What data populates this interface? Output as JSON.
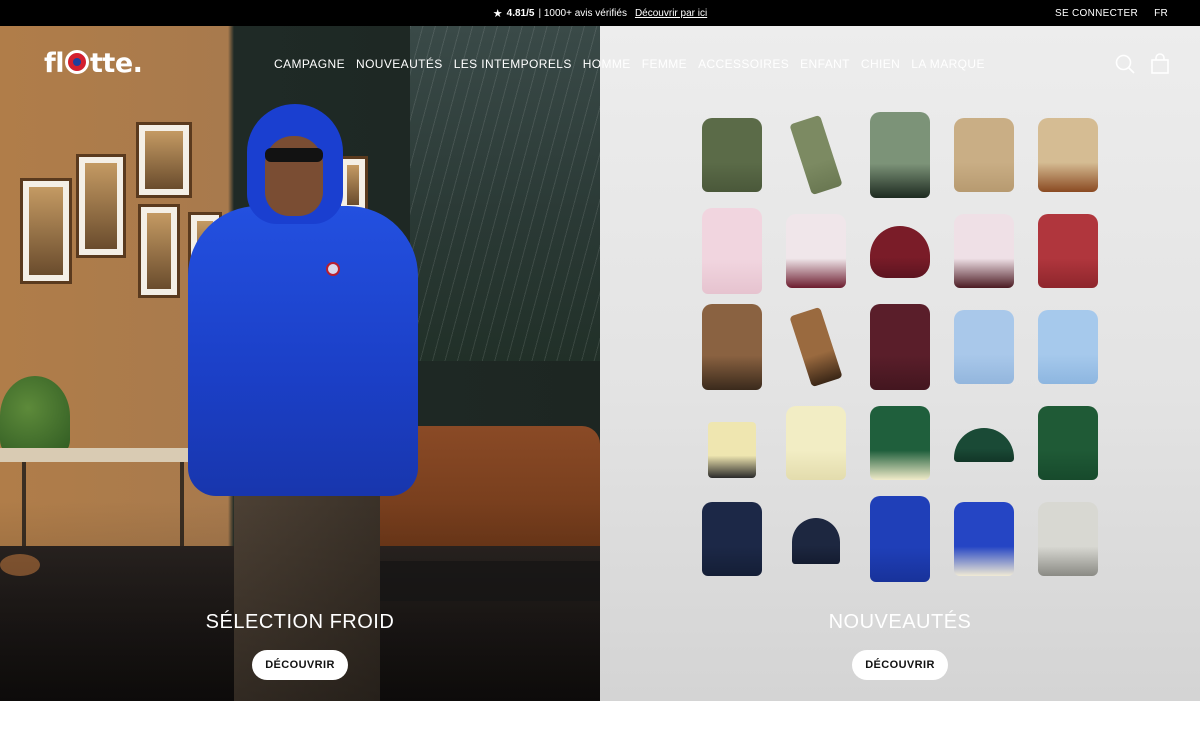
{
  "topbar": {
    "star": "★",
    "rating": "4.81/5",
    "reviews": "| 1000+ avis vérifiés",
    "link": "Découvrir par ici",
    "login": "SE CONNECTER",
    "lang": "FR"
  },
  "brand": {
    "logo_pre": "fl",
    "logo_post": "tte."
  },
  "nav": [
    "CAMPAGNE",
    "NOUVEAUTÉS",
    "LES INTEMPORELS",
    "HOMME",
    "FEMME",
    "ACCESSOIRES",
    "ENFANT",
    "CHIEN",
    "LA MARQUE"
  ],
  "icons": {
    "search": "search-icon",
    "cart": "shopping-bag-icon"
  },
  "hero_left": {
    "title": "SÉLECTION FROID",
    "button": "DÉCOUVRIR"
  },
  "hero_right": {
    "title": "NOUVEAUTÉS",
    "button": "DÉCOUVRIR"
  },
  "products": [
    {
      "kind": "jacket",
      "color": "#5b6b48",
      "accent": "#4a583a"
    },
    {
      "kind": "scarf",
      "color": "#7c8a62",
      "accent": "#6a7852"
    },
    {
      "kind": "coat",
      "color": "#7c9378",
      "accent": "#1d2a20"
    },
    {
      "kind": "jacket",
      "color": "#c9ae85",
      "accent": "#b79a70"
    },
    {
      "kind": "jacket",
      "color": "#d5bc93",
      "accent": "#8a4a22"
    },
    {
      "kind": "coat",
      "color": "#f1d5df",
      "accent": "#e6c3cf"
    },
    {
      "kind": "jacket",
      "color": "#f0e6ea",
      "accent": "#6c1c2e"
    },
    {
      "kind": "hood",
      "color": "#7a1c28",
      "accent": "#5c1420"
    },
    {
      "kind": "jacket",
      "color": "#efe0e6",
      "accent": "#4b1a22"
    },
    {
      "kind": "jacket",
      "color": "#b0363d",
      "accent": "#8e262c"
    },
    {
      "kind": "coat",
      "color": "#8a6241",
      "accent": "#3a2a1c"
    },
    {
      "kind": "scarf",
      "color": "#9a6a3f",
      "accent": "#3a2616"
    },
    {
      "kind": "coat",
      "color": "#5a1e2a",
      "accent": "#43161f"
    },
    {
      "kind": "jacket",
      "color": "#a9c8ea",
      "accent": "#93b6dd"
    },
    {
      "kind": "jacket",
      "color": "#a6c9ec",
      "accent": "#8db6e0"
    },
    {
      "kind": "bag",
      "color": "#efe6b0",
      "accent": "#2a2a2a"
    },
    {
      "kind": "jacket",
      "color": "#f2edc4",
      "accent": "#e3dcad"
    },
    {
      "kind": "jacket",
      "color": "#1f5f3c",
      "accent": "#f1ebc9"
    },
    {
      "kind": "cap",
      "color": "#1a4a36",
      "accent": "#123627"
    },
    {
      "kind": "jacket",
      "color": "#1f5a36",
      "accent": "#174a2c"
    },
    {
      "kind": "jacket",
      "color": "#1c2847",
      "accent": "#141e36"
    },
    {
      "kind": "beanie",
      "color": "#1d2740",
      "accent": "#141c30"
    },
    {
      "kind": "coat",
      "color": "#1f3fb8",
      "accent": "#18329a"
    },
    {
      "kind": "jacket",
      "color": "#2545c4",
      "accent": "#f0ead5"
    },
    {
      "kind": "jacket",
      "color": "#d8d8d2",
      "accent": "#8a8a84"
    }
  ]
}
